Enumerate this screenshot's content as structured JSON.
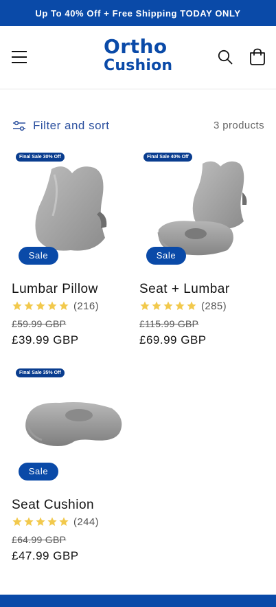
{
  "announcement": "Up To 40% Off + Free Shipping TODAY ONLY",
  "brand": {
    "line1": "Ortho",
    "line2": "Cushion"
  },
  "colors": {
    "brand_blue": "#0a4aa8",
    "star": "#f2c94c"
  },
  "filter": {
    "label": "Filter and sort",
    "count": "3 products"
  },
  "products": [
    {
      "badge": "Final Sale 30% Off",
      "sale_label": "Sale",
      "title": "Lumbar Pillow",
      "rating": 5,
      "reviews": "(216)",
      "old_price": "£59.99 GBP",
      "price": "£39.99 GBP"
    },
    {
      "badge": "Final Sale 40% Off",
      "sale_label": "Sale",
      "title": "Seat + Lumbar",
      "rating": 5,
      "reviews": "(285)",
      "old_price": "£115.99 GBP",
      "price": "£69.99 GBP"
    },
    {
      "badge": "Final Sale 35% Off",
      "sale_label": "Sale",
      "title": "Seat Cushion",
      "rating": 5,
      "reviews": "(244)",
      "old_price": "£64.99 GBP",
      "price": "£47.99 GBP"
    }
  ],
  "icons": {
    "menu": "hamburger-menu-icon",
    "search": "search-icon",
    "cart": "cart-icon",
    "filter": "filter-sliders-icon",
    "star": "star-icon"
  }
}
